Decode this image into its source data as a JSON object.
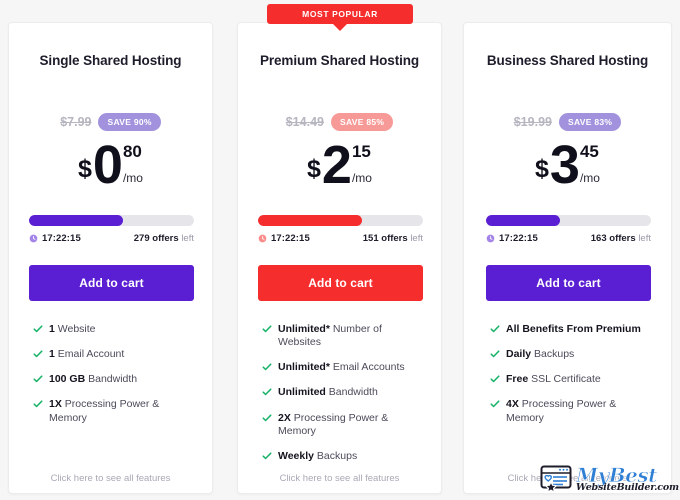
{
  "ribbon": {
    "label": "MOST POPULAR"
  },
  "colors": {
    "purple": "#5a1fd2",
    "red": "#f52d2d",
    "save_purple": "#a292dd",
    "save_red": "#f79a97",
    "tick_green": "#18b368",
    "old_price_gray": "#b6b6c0",
    "muted_gray": "#a9a9b6"
  },
  "plans": [
    {
      "title": "Single Shared Hosting",
      "old_price": "$7.99",
      "save_badge": "SAVE 90%",
      "currency": "$",
      "whole": "0",
      "fraction": "80",
      "per": "/mo",
      "progress_percent": 57,
      "timer": "17:22:15",
      "offers_count": "279",
      "offers_label": "offers",
      "offers_suffix": "left",
      "cta": "Add to cart",
      "features": [
        {
          "strong": "1",
          "rest": "Website"
        },
        {
          "strong": "1",
          "rest": "Email Account"
        },
        {
          "strong": "100 GB",
          "rest": "Bandwidth"
        },
        {
          "strong": "1X",
          "rest": "Processing Power & Memory"
        }
      ],
      "all_features": "Click here to see all features"
    },
    {
      "title": "Premium Shared Hosting",
      "old_price": "$14.49",
      "save_badge": "SAVE 85%",
      "currency": "$",
      "whole": "2",
      "fraction": "15",
      "per": "/mo",
      "progress_percent": 63,
      "timer": "17:22:15",
      "offers_count": "151",
      "offers_label": "offers",
      "offers_suffix": "left",
      "cta": "Add to cart",
      "features": [
        {
          "strong": "Unlimited*",
          "rest": "Number of Websites"
        },
        {
          "strong": "Unlimited*",
          "rest": "Email Accounts"
        },
        {
          "strong": "Unlimited",
          "rest": "Bandwidth"
        },
        {
          "strong": "2X",
          "rest": "Processing Power & Memory"
        },
        {
          "strong": "Weekly",
          "rest": "Backups"
        }
      ],
      "all_features": "Click here to see all features"
    },
    {
      "title": "Business Shared Hosting",
      "old_price": "$19.99",
      "save_badge": "SAVE 83%",
      "currency": "$",
      "whole": "3",
      "fraction": "45",
      "per": "/mo",
      "progress_percent": 45,
      "timer": "17:22:15",
      "offers_count": "163",
      "offers_label": "offers",
      "offers_suffix": "left",
      "cta": "Add to cart",
      "features": [
        {
          "strong": "All Benefits From Premium",
          "rest": ""
        },
        {
          "strong": "Daily",
          "rest": "Backups"
        },
        {
          "strong": "Free",
          "rest": "SSL Certificate"
        },
        {
          "strong": "4X",
          "rest": "Processing Power & Memory"
        }
      ],
      "all_features": "Click here to see all features"
    }
  ],
  "watermark": {
    "name": "MyBest",
    "domain": "WebsiteBuilder.com"
  }
}
